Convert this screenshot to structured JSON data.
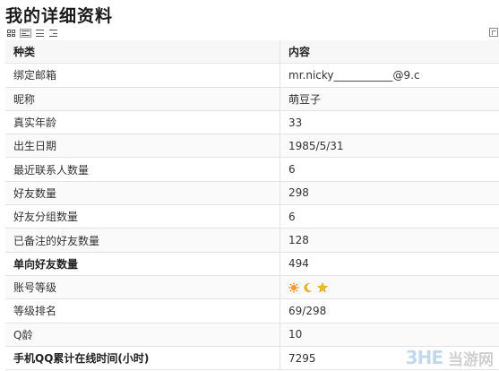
{
  "page": {
    "title": "我的详细资料"
  },
  "table": {
    "headers": [
      "种类",
      "内容"
    ],
    "rows": [
      {
        "label": "绑定邮箱",
        "value": "mr.nicky___________@9.c"
      },
      {
        "label": "昵称",
        "value": "萌豆子"
      },
      {
        "label": "真实年龄",
        "value": "33"
      },
      {
        "label": "出生日期",
        "value": "1985/5/31"
      },
      {
        "label": "最近联系人数量",
        "value": "6"
      },
      {
        "label": "好友数量",
        "value": "298"
      },
      {
        "label": "好友分组数量",
        "value": "6"
      },
      {
        "label": "已备注的好友数量",
        "value": "128"
      },
      {
        "label": "单向好友数量",
        "value": "494"
      },
      {
        "label": "账号等级",
        "value": ""
      },
      {
        "label": "等级排名",
        "value": "69/298"
      },
      {
        "label": "Q龄",
        "value": "10"
      },
      {
        "label": "手机QQ累计在线时间(小时)",
        "value": "7295"
      }
    ],
    "level_icons": [
      "sun-icon",
      "moon-icon",
      "star-icon"
    ]
  },
  "watermark": {
    "logo": "3HE",
    "text": "当游网"
  },
  "colors": {
    "header_bg": "#f7f7f7",
    "border": "#e3e3e3",
    "sun": "#f0a020",
    "moon": "#e8b020",
    "star": "#f2c21a"
  }
}
